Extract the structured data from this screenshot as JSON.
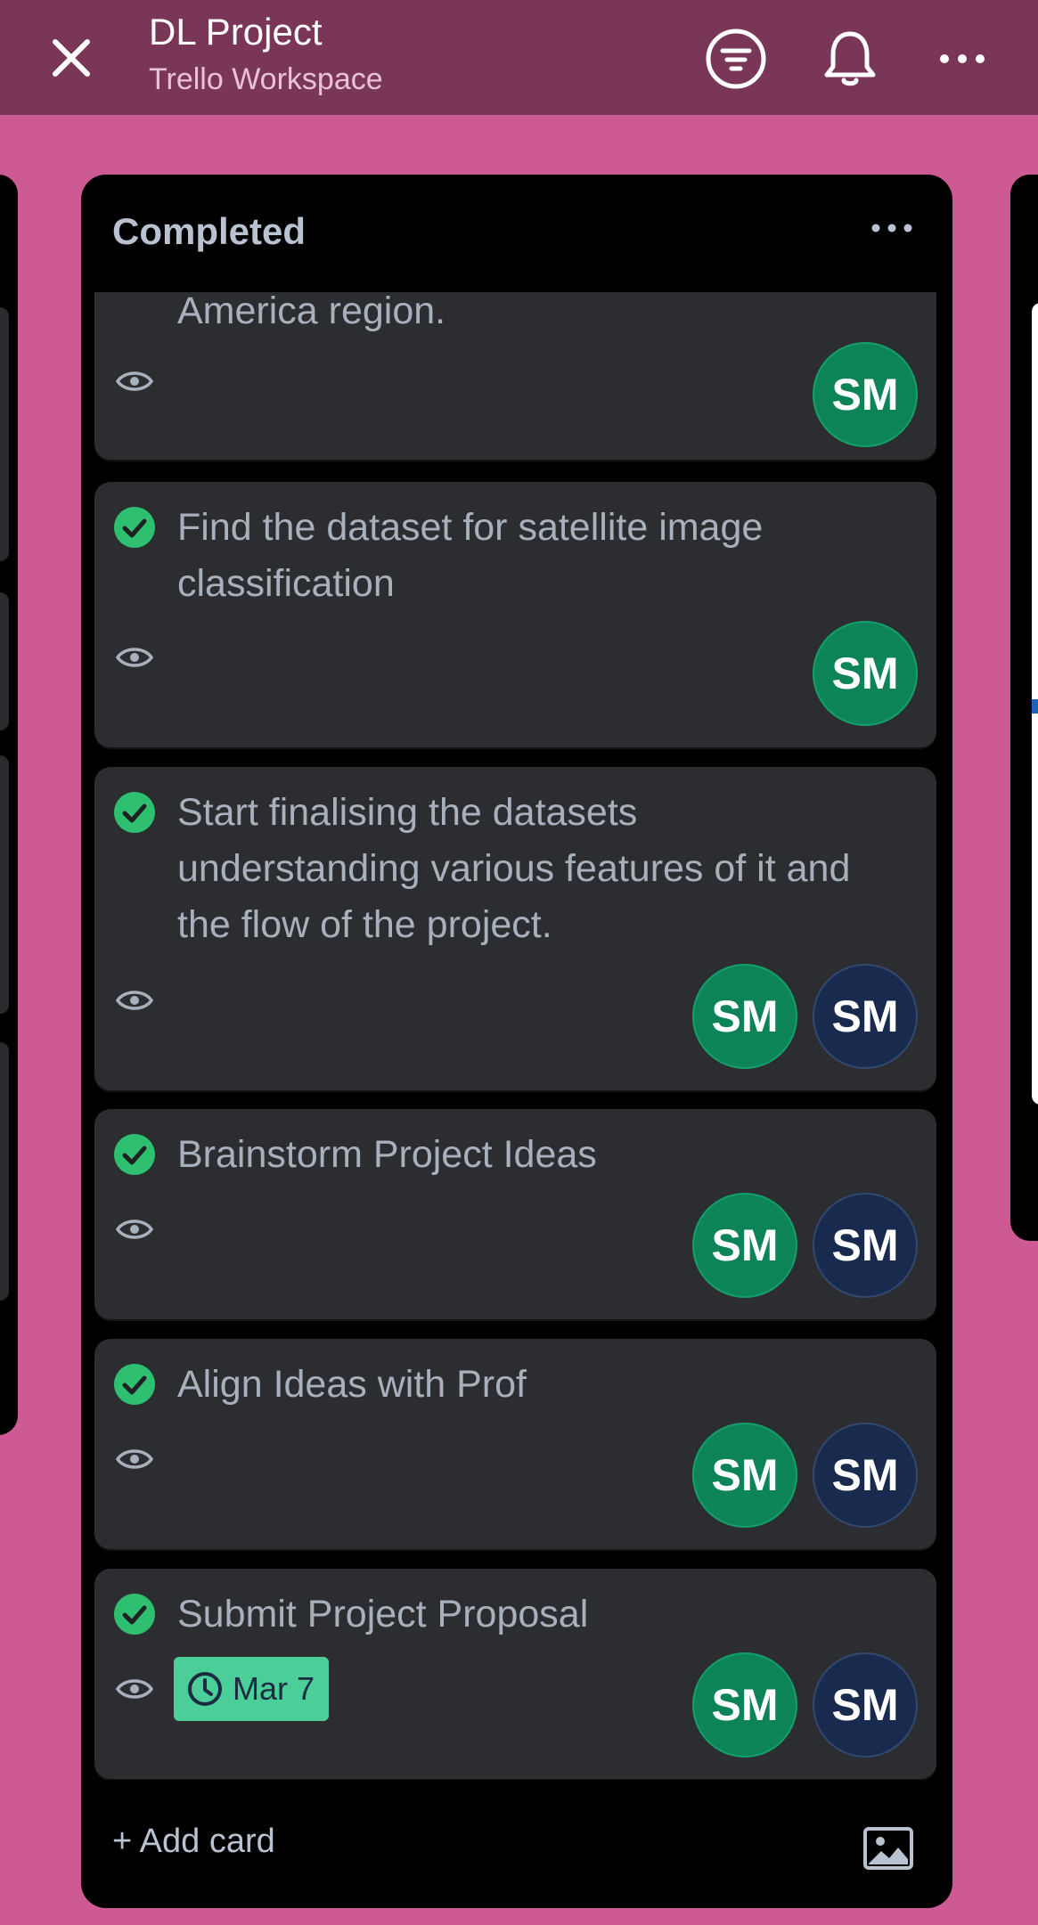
{
  "header": {
    "title": "DL Project",
    "subtitle": "Trello Workspace",
    "icons": [
      "close-icon",
      "filter-icon",
      "bell-icon",
      "more-horizontal-icon"
    ]
  },
  "list": {
    "title": "Completed",
    "add_card_label": "+ Add card",
    "cards": [
      {
        "title": "America region.",
        "avatars": [
          "SM"
        ],
        "partially_visible": true
      },
      {
        "title": "Find the dataset for satellite image classification",
        "avatars": [
          "SM"
        ],
        "completed": true
      },
      {
        "title": "Start finalising the datasets understanding various features of it and the flow of the project.",
        "avatars": [
          "SM",
          "SM"
        ],
        "completed": true
      },
      {
        "title": "Brainstorm Project Ideas",
        "avatars": [
          "SM",
          "SM"
        ],
        "completed": true
      },
      {
        "title": "Align Ideas with Prof",
        "avatars": [
          "SM",
          "SM"
        ],
        "completed": true
      },
      {
        "title": "Submit Project Proposal",
        "avatars": [
          "SM",
          "SM"
        ],
        "completed": true,
        "due": "Mar 7"
      }
    ]
  },
  "colors": {
    "board_background": "#cd5a92",
    "header": "#7a3656",
    "card": "#2c2d30",
    "check_green": "#2fbf71",
    "avatar_green": "#0d8358",
    "avatar_navy": "#182a4e",
    "due_badge": "#4bce97"
  }
}
